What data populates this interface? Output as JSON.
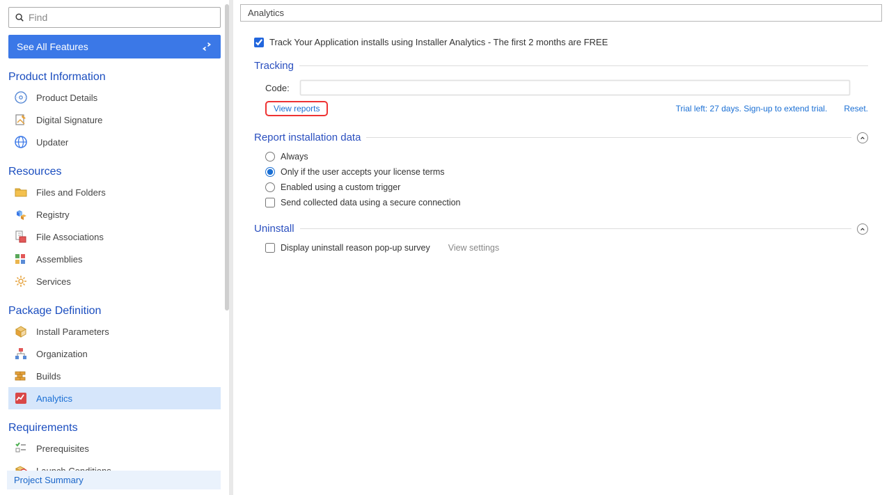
{
  "search": {
    "placeholder": "Find"
  },
  "see_all": {
    "label": "See All Features"
  },
  "sections": {
    "product_information": {
      "title": "Product Information",
      "items": [
        {
          "id": "product-details",
          "label": "Product Details"
        },
        {
          "id": "digital-signature",
          "label": "Digital Signature"
        },
        {
          "id": "updater",
          "label": "Updater"
        }
      ]
    },
    "resources": {
      "title": "Resources",
      "items": [
        {
          "id": "files-and-folders",
          "label": "Files and Folders"
        },
        {
          "id": "registry",
          "label": "Registry"
        },
        {
          "id": "file-associations",
          "label": "File Associations"
        },
        {
          "id": "assemblies",
          "label": "Assemblies"
        },
        {
          "id": "services",
          "label": "Services"
        }
      ]
    },
    "package_definition": {
      "title": "Package Definition",
      "items": [
        {
          "id": "install-parameters",
          "label": "Install Parameters"
        },
        {
          "id": "organization",
          "label": "Organization"
        },
        {
          "id": "builds",
          "label": "Builds"
        },
        {
          "id": "analytics",
          "label": "Analytics"
        }
      ]
    },
    "requirements": {
      "title": "Requirements",
      "items": [
        {
          "id": "prerequisites",
          "label": "Prerequisites"
        },
        {
          "id": "launch-conditions",
          "label": "Launch Conditions"
        }
      ]
    }
  },
  "project_summary": {
    "label": "Project Summary"
  },
  "page": {
    "title": "Analytics",
    "track_check": {
      "label": "Track Your Application installs using Installer Analytics - The first 2 months are FREE",
      "checked": true
    },
    "tracking": {
      "title": "Tracking",
      "code_label": "Code:",
      "code_value": "",
      "view_reports": "View reports",
      "trial_text": "Trial left: 27 days. Sign-up to extend trial.",
      "reset": "Reset."
    },
    "report": {
      "title": "Report installation data",
      "radios": {
        "always": "Always",
        "license": "Only if the user accepts your license terms",
        "custom": "Enabled using a custom trigger"
      },
      "selected": "license",
      "secure_check": {
        "label": "Send collected data using a secure connection",
        "checked": false
      }
    },
    "uninstall": {
      "title": "Uninstall",
      "survey_check": {
        "label": "Display uninstall reason pop-up survey",
        "checked": false
      },
      "view_settings": "View settings"
    }
  }
}
